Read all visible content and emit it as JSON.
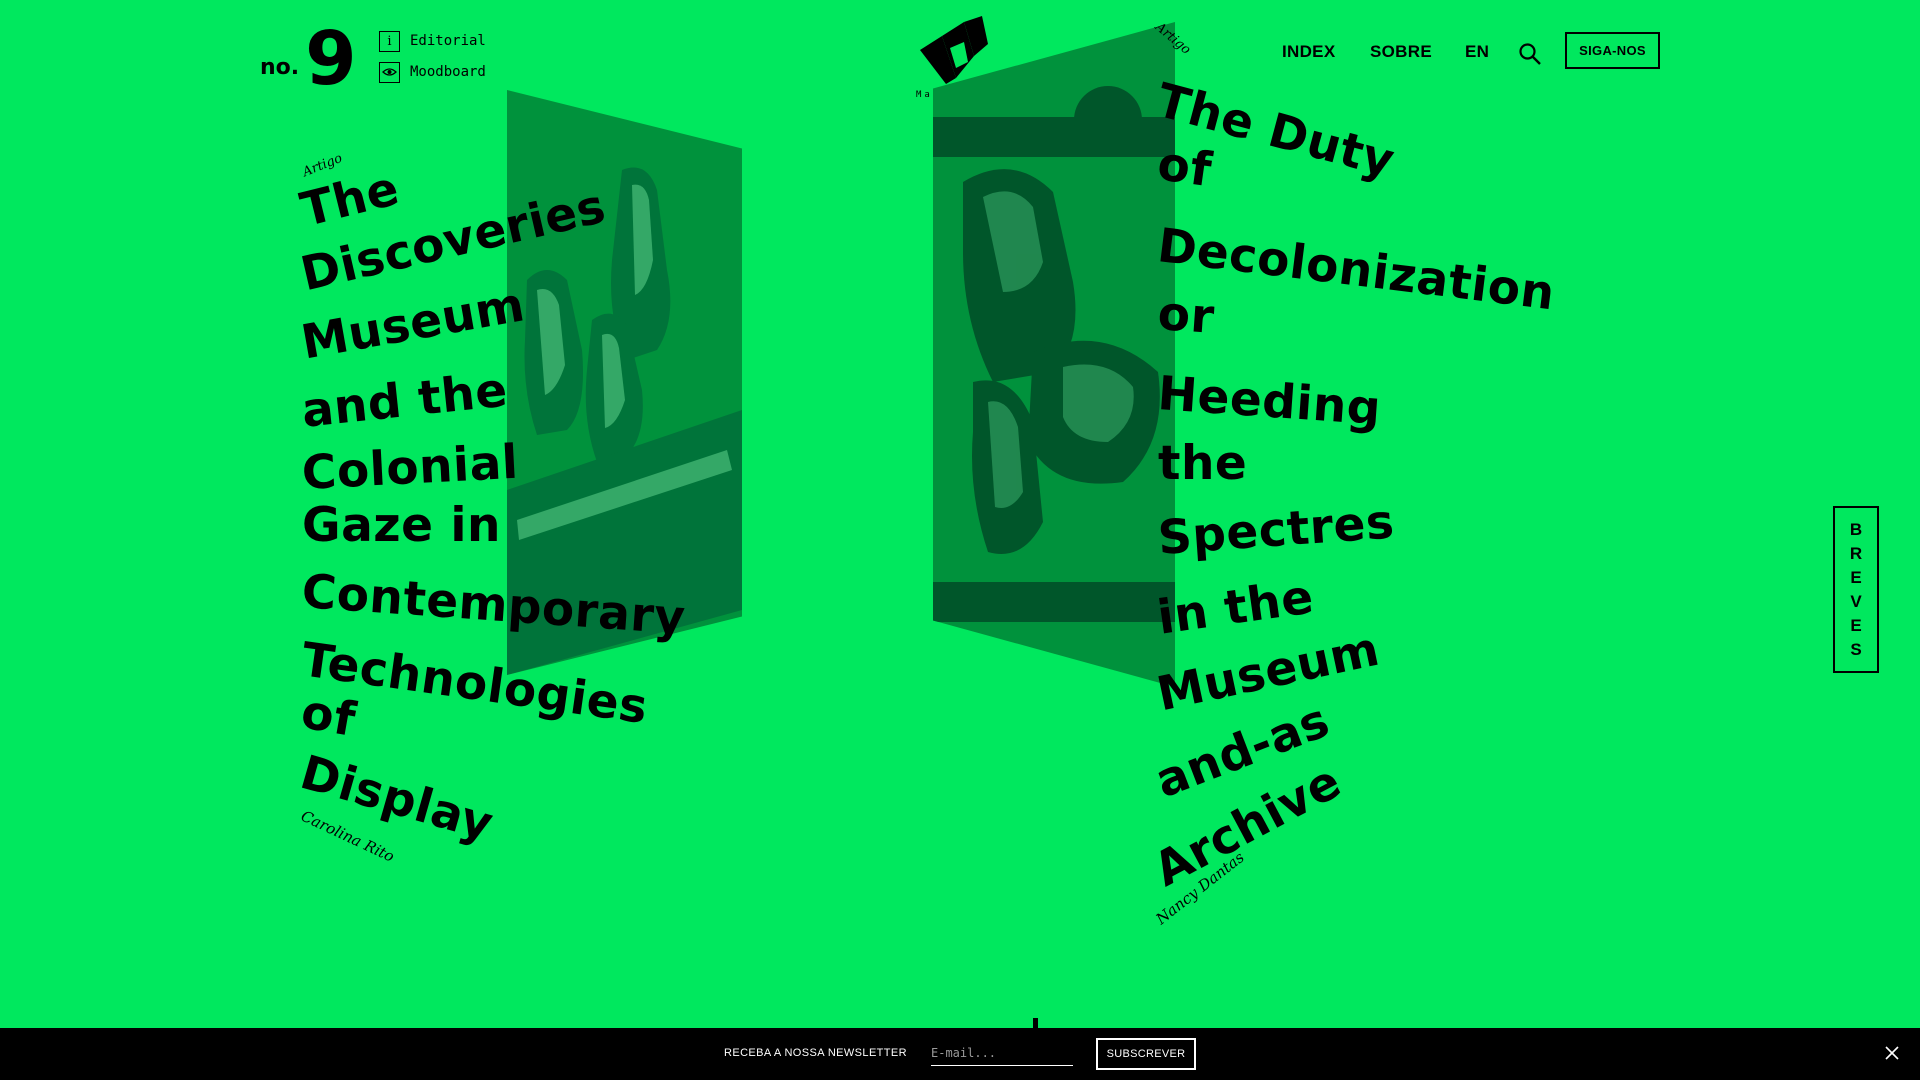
{
  "issue": {
    "prefix": "no.",
    "number": "9"
  },
  "sublinks": [
    {
      "label": "Editorial",
      "icon": "info-icon"
    },
    {
      "label": "Moodboard",
      "icon": "eye-icon"
    }
  ],
  "logo": {
    "wordmark": "Magazine."
  },
  "nav": {
    "index": "INDEX",
    "sobre": "SOBRE",
    "lang": "EN",
    "follow": "SIGA-NOS"
  },
  "articles": [
    {
      "kicker": "Artigo",
      "title_lines": [
        "The",
        "Discoveries",
        "Museum",
        "and the",
        "Colonial",
        "Gaze in",
        "Contemporary",
        "Technologies",
        "of",
        "Display"
      ],
      "author": "Carolina Rito"
    },
    {
      "kicker": "Artigo",
      "title_lines": [
        "The Duty",
        "of",
        "Decolonization",
        "or",
        "Heeding",
        "the",
        "Spectres",
        "in the",
        "Museum",
        "and-as",
        "Archive"
      ],
      "author": "Nancy Dantas"
    }
  ],
  "breves": {
    "letters": [
      "B",
      "R",
      "E",
      "V",
      "E",
      "S"
    ]
  },
  "newsletter": {
    "label": "RECEBA A NOSSA NEWSLETTER",
    "placeholder": "E-mail...",
    "button": "SUBSCREVER"
  },
  "colors": {
    "background": "#00e85e",
    "panel": "#00923c",
    "ink": "#000000",
    "bar": "#000000"
  }
}
